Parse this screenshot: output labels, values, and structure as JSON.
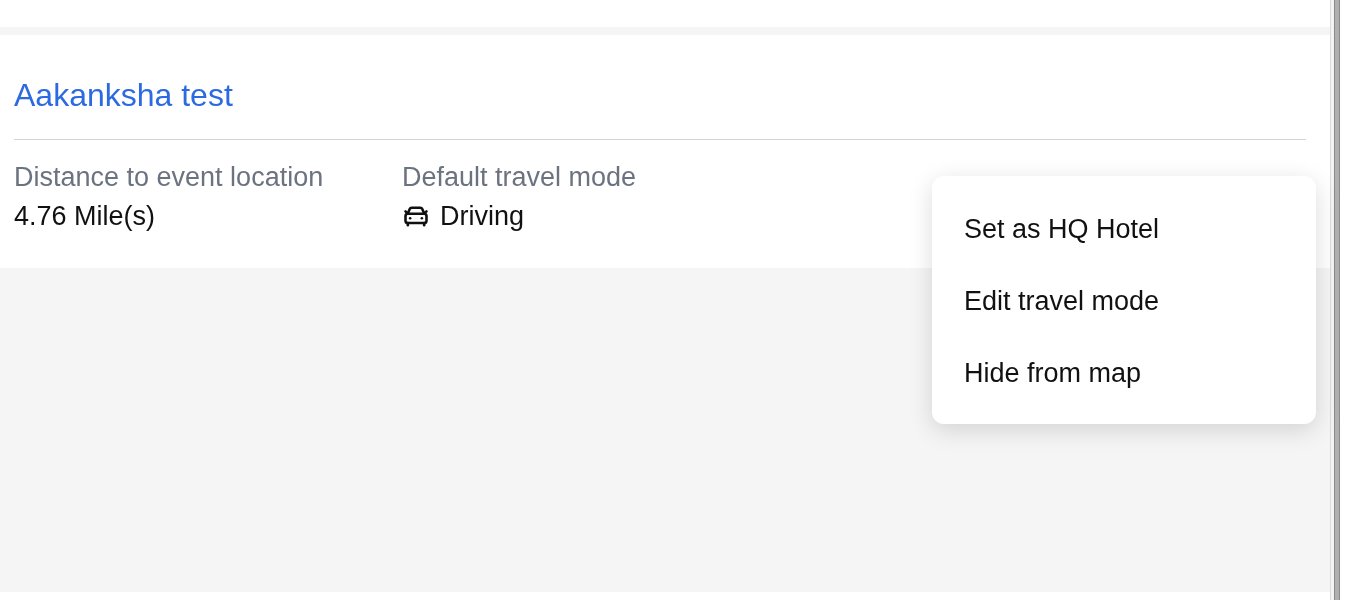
{
  "card": {
    "title": "Aakanksha test",
    "fields": [
      {
        "kind": "text",
        "label": "Distance to event location",
        "value": "4.76 Mile(s)"
      },
      {
        "kind": "mode",
        "label": "Default travel mode",
        "value": "Driving"
      }
    ]
  },
  "menu": {
    "items": [
      "Set as HQ Hotel",
      "Edit travel mode",
      "Hide from map"
    ]
  }
}
